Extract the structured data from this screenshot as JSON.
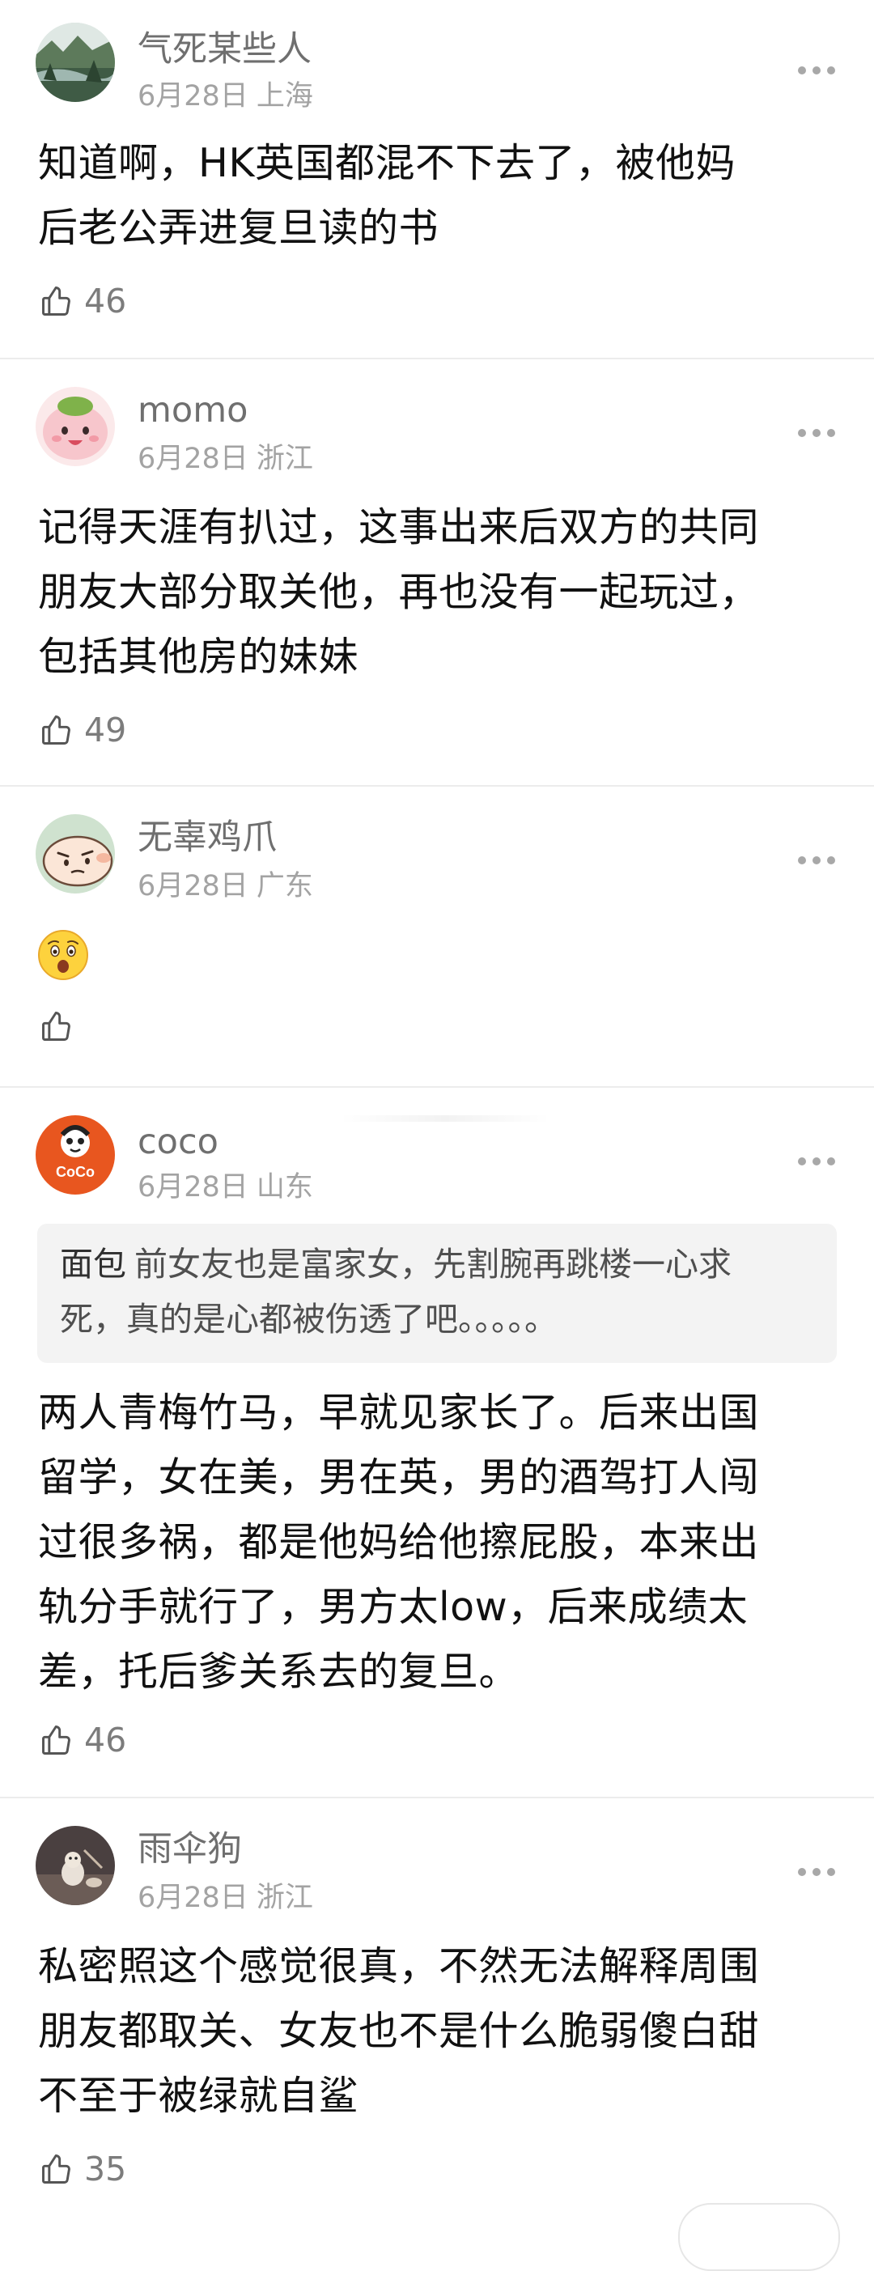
{
  "comments": [
    {
      "username": "气死某些人",
      "date": "6月28日",
      "location": "上海",
      "text": "知道啊，HK英国都混不下去了，被他妈\n后老公弄进复旦读的书",
      "likes": "46"
    },
    {
      "username": "momo",
      "date": "6月28日",
      "location": "浙江",
      "text": "记得天涯有扒过，这事出来后双方的共同\n朋友大部分取关他，再也没有一起玩过，\n包括其他房的妹妹",
      "likes": "49"
    },
    {
      "username": "无辜鸡爪",
      "date": "6月28日",
      "location": "广东",
      "emoji": "astonished-face",
      "likes": ""
    },
    {
      "username": "coco",
      "date": "6月28日",
      "location": "山东",
      "quote_author": "面包",
      "quote_text": "前女友也是富家女，先割腕再跳楼一心求\n死，真的是心都被伤透了吧。。。。。",
      "text": "两人青梅竹马，早就见家长了。后来出国\n留学，女在美，男在英，男的酒驾打人闯\n过很多祸，都是他妈给他擦屁股，本来出\n轨分手就行了，男方太low，后来成绩太\n差，托后爹关系去的复旦。",
      "likes": "46"
    },
    {
      "username": "雨伞狗",
      "date": "6月28日",
      "location": "浙江",
      "text": "私密照这个感觉很真，不然无法解释周围\n朋友都取关、女友也不是什么脆弱傻白甜\n不至于被绿就自鲨",
      "likes": "35"
    }
  ],
  "colors": {
    "username": "#6f6f6f",
    "meta": "#a3a3a3",
    "text": "#111111",
    "divider": "#ececec",
    "quote_bg": "#f3f3f3",
    "coco_orange": "#e8561f"
  },
  "icons": {
    "like": "thumbs-up-icon",
    "more": "more-dots-icon"
  }
}
